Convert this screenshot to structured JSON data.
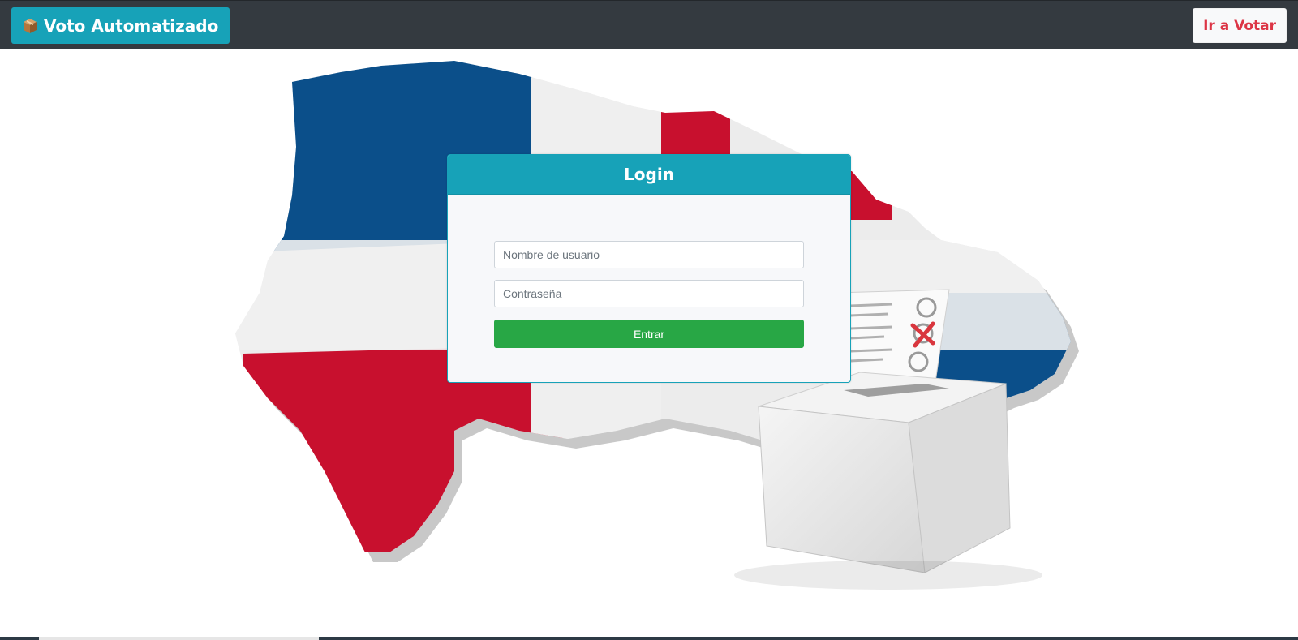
{
  "navbar": {
    "brand_label": "Voto Automatizado",
    "brand_icon": "ballot-box-icon",
    "vote_button_label": "Ir a Votar"
  },
  "login": {
    "title": "Login",
    "username_placeholder": "Nombre de usuario",
    "password_placeholder": "Contraseña",
    "submit_label": "Entrar"
  },
  "colors": {
    "navbar_bg": "#343a40",
    "brand_bg": "#17a2b8",
    "vote_text": "#dc3545",
    "submit_bg": "#28a745",
    "flag_blue": "#0b4f8a",
    "flag_red": "#c8102e"
  }
}
